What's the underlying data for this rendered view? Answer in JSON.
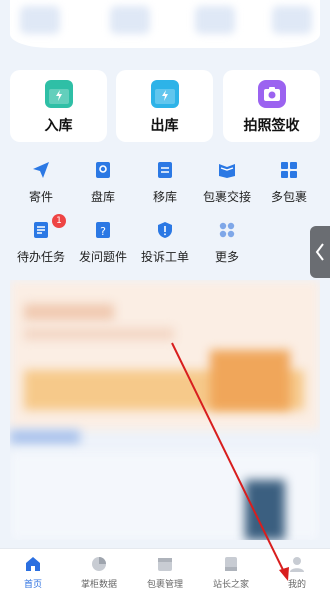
{
  "top_cards": 4,
  "main_actions": [
    {
      "label": "入库",
      "icon": "inbound-box-icon"
    },
    {
      "label": "出库",
      "icon": "outbound-box-icon"
    },
    {
      "label": "拍照签收",
      "icon": "camera-icon"
    }
  ],
  "grid_items": [
    {
      "label": "寄件",
      "icon": "send-plane-icon"
    },
    {
      "label": "盘库",
      "icon": "inventory-check-icon"
    },
    {
      "label": "移库",
      "icon": "transfer-icon"
    },
    {
      "label": "包裹交接",
      "icon": "handover-icon"
    },
    {
      "label": "多包裹",
      "icon": "multi-package-icon"
    },
    {
      "label": "待办任务",
      "icon": "todo-icon",
      "badge": "1"
    },
    {
      "label": "发问题件",
      "icon": "problem-parcel-icon"
    },
    {
      "label": "投诉工单",
      "icon": "complaint-icon"
    },
    {
      "label": "更多",
      "icon": "more-dots-icon"
    }
  ],
  "tabbar": [
    {
      "label": "首页",
      "icon": "home-icon",
      "active": true
    },
    {
      "label": "掌柜数据",
      "icon": "data-pie-icon"
    },
    {
      "label": "包裹管理",
      "icon": "package-manage-icon"
    },
    {
      "label": "站长之家",
      "icon": "book-icon"
    },
    {
      "label": "我的",
      "icon": "profile-icon"
    }
  ],
  "colors": {
    "accent": "#2b6fe0",
    "badge": "#ee4444",
    "arrow": "#d81e1e"
  }
}
